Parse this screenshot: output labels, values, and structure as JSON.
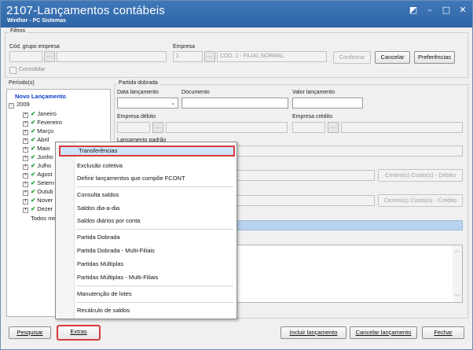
{
  "window": {
    "title": "2107-Lançamentos contábeis",
    "subtitle": "Winthor - PC Sistemas"
  },
  "filters": {
    "group_title": "Filtros",
    "cod_grupo_label": "Cód. grupo empresa",
    "empresa_label": "Empresa",
    "empresa_code": "1",
    "empresa_name": "COD. 1 - FILIAL NORMAL",
    "consolidar_label": "Consolidar",
    "confirmar_label": "Confirmar",
    "cancelar_label": "Cancelar",
    "preferencias_label": "Preferências"
  },
  "periodo": {
    "group_title": "Período(s)",
    "novo_lancamento": "Novo Lançamento",
    "year": "2009",
    "months": [
      "Janeiro",
      "Fevereiro",
      "Março",
      "Abril",
      "Maio",
      "Junho",
      "Julho",
      "Agosto",
      "Setembro",
      "Outubro",
      "Novembro",
      "Dezembro"
    ],
    "months_visible": [
      "Janeiro",
      "Fevereiro",
      "Março",
      "Abril",
      "Maio",
      "Junho",
      "Julho",
      "Agost",
      "Setem",
      "Outub",
      "Nover",
      "Dezer"
    ],
    "todos": "Todos me"
  },
  "partida": {
    "group_title": "Partida dobrada",
    "data_lancamento_label": "Data lançamento",
    "documento_label": "Documento",
    "valor_lancamento_label": "Valor lançamento",
    "empresa_debito_label": "Empresa débito",
    "empresa_credito_label": "Empresa crédito",
    "lancamento_padrao_label": "Lançamento padrão",
    "centro_debito_label": "Centro(s) Custo(s) - Débito",
    "centro_credito_label": "Centro(s) Custo(s) - Crédito"
  },
  "context_menu": {
    "items": [
      "Transferências",
      "Exclusão coletiva",
      "Definir lançamentos que compõe FCONT",
      "Consulta saldos",
      "Saldos dia-a-dia",
      "Saldos diários por conta",
      "Partida Dobrada",
      "Partida Dobrada - Multi-Filiais",
      "Partidas Múltiplas",
      "Partidas Múltiplas - Multi-Filiais",
      "Manutenção de lotes",
      "Recálculo de saldos"
    ],
    "selected_index": 0
  },
  "bottom_buttons": {
    "pesquisar": "Pesquisar",
    "extras": "Extras",
    "incluir": "Incluir lançamento",
    "cancelar_lancamento": "Cancelar lançamento",
    "fechar": "Fechar"
  },
  "colors": {
    "titlebar": "#2f65a6",
    "highlight_outline": "#d73a3a",
    "menu_selected": "#cfe4fb",
    "tree_new": "#0b3fd1",
    "check": "#1aa12b"
  }
}
